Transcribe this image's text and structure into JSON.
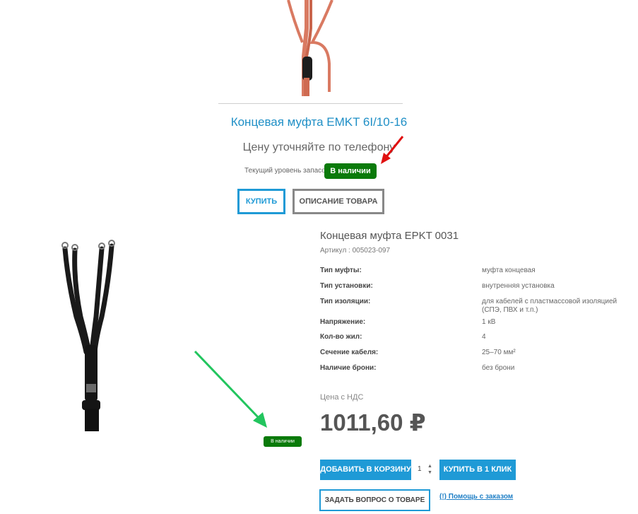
{
  "top_product": {
    "title": "Концевая муфта EMKT 6I/10-16",
    "price_note": "Цену уточняйте по телефону",
    "stock_label": "Текущий уровень запасов",
    "stock_badge": "В наличии",
    "buy_label": "КУПИТЬ",
    "description_label": "ОПИСАНИЕ ТОВАРА"
  },
  "product": {
    "title": "Концевая муфта EPKT 0031",
    "sku": "Артикул : 005023-097",
    "stock_badge": "В наличии",
    "specs": [
      {
        "name": "Тип муфты:",
        "value": "муфта концевая"
      },
      {
        "name": "Тип установки:",
        "value": "внутренняя установка"
      },
      {
        "name": "Тип изоляции:",
        "value": "для кабелей с пластмассовой изоляцией (СПЭ, ПВХ и т.п.)"
      },
      {
        "name": "Напряжение:",
        "value": "1 кВ"
      },
      {
        "name": "Кол-во жил:",
        "value": "4"
      },
      {
        "name": "Сечение кабеля:",
        "value": "25–70 мм²"
      },
      {
        "name": "Наличие брони:",
        "value": "без брони"
      }
    ],
    "price_label": "Цена с НДС",
    "price": "1011,60 ₽",
    "add_to_cart_label": "ДОБАВИТЬ В КОРЗИНУ",
    "quantity": "1",
    "one_click_label": "КУПИТЬ В 1 КЛИК",
    "ask_label": "ЗАДАТЬ ВОПРОС О ТОВАРЕ",
    "help_link": "(!) Помощь с заказом"
  },
  "colors": {
    "accent": "#1f9ad6",
    "stock_green": "#0a7a0a",
    "annotation_red": "#e01010",
    "annotation_green": "#22c55e"
  }
}
